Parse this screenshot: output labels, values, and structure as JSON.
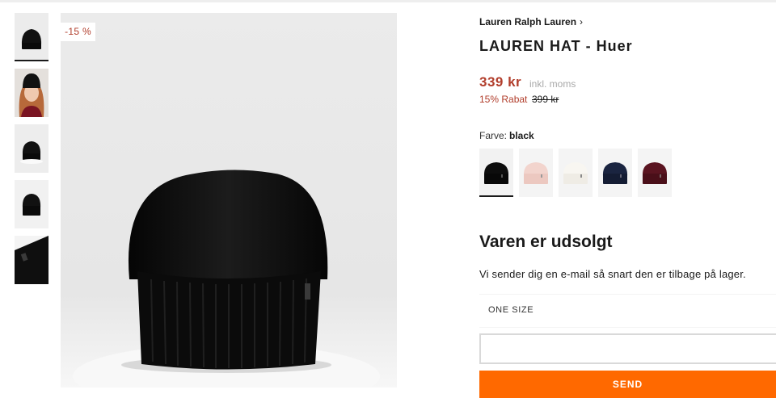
{
  "badge": "-15 %",
  "brand": "Lauren Ralph Lauren",
  "product_title": "LAUREN HAT - Huer",
  "price": "339 kr",
  "vat_note": "inkl. moms",
  "discount_label": "15% Rabat",
  "old_price": "399 kr",
  "color": {
    "label": "Farve:",
    "selected": "black"
  },
  "swatches": [
    {
      "color": "#0d0d0d",
      "selected": true
    },
    {
      "color": "#f2d4cd",
      "selected": false
    },
    {
      "color": "#f5f3ee",
      "selected": false
    },
    {
      "color": "#1a2440",
      "selected": false
    },
    {
      "color": "#5a1420",
      "selected": false
    }
  ],
  "sold_out": {
    "title": "Varen er udsolgt",
    "text": "Vi sender dig en e-mail så snart den er tilbage på lager."
  },
  "size": "ONE SIZE",
  "email_input": {
    "value": "",
    "placeholder": ""
  },
  "send_label": "SEND",
  "colors": {
    "price": "#b13d2b",
    "button": "#ff6900"
  }
}
